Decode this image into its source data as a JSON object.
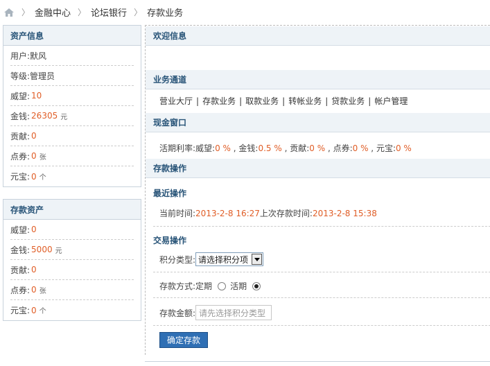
{
  "breadcrumb": {
    "items": [
      "金融中心",
      "论坛银行",
      "存款业务"
    ]
  },
  "assets": {
    "title": "资产信息",
    "rows": [
      {
        "label": "用户: ",
        "value": "默风",
        "unit": ""
      },
      {
        "label": "等级: ",
        "value": "管理员",
        "unit": ""
      },
      {
        "label": "威望: ",
        "value": "10",
        "unit": ""
      },
      {
        "label": "金钱: ",
        "value": "26305",
        "unit": "元"
      },
      {
        "label": "贡献: ",
        "value": "0",
        "unit": ""
      },
      {
        "label": "点券: ",
        "value": "0",
        "unit": "张"
      },
      {
        "label": "元宝: ",
        "value": "0",
        "unit": "个"
      }
    ]
  },
  "deposits": {
    "title": "存款资产",
    "rows": [
      {
        "label": "威望: ",
        "value": "0",
        "unit": ""
      },
      {
        "label": "金钱: ",
        "value": "5000",
        "unit": "元"
      },
      {
        "label": "贡献: ",
        "value": "0",
        "unit": ""
      },
      {
        "label": "点券: ",
        "value": "0",
        "unit": "张"
      },
      {
        "label": "元宝: ",
        "value": "0",
        "unit": "个"
      }
    ]
  },
  "main": {
    "welcome_title": "欢迎信息",
    "channel_title": "业务通道",
    "channels": [
      "营业大厅",
      "存款业务",
      "取款业务",
      "转帐业务",
      "贷款业务",
      "帐户管理"
    ],
    "cash_title": "现金窗口",
    "rate": {
      "prefix": "活期利率: ",
      "items": [
        {
          "label": "威望: ",
          "value": "0 %"
        },
        {
          "label": "金钱: ",
          "value": "0.5 %"
        },
        {
          "label": "贡献: ",
          "value": "0 %"
        },
        {
          "label": "点券: ",
          "value": "0 %"
        },
        {
          "label": "元宝: ",
          "value": "0 %"
        }
      ]
    },
    "deposit_title": "存款操作",
    "recent_title": "最近操作",
    "time_label": "当前时间: ",
    "time_value": "2013-2-8 16:27",
    "last_label": " 上次存款时间: ",
    "last_value": "2013-2-8 15:38",
    "trade_title": "交易操作",
    "type_label": "积分类型: ",
    "type_select": "请选择积分项",
    "method_label": "存款方式: ",
    "method_fixed": "定期",
    "method_current": "活期",
    "amount_label": "存款金额: ",
    "amount_placeholder": "请先选择积分类型",
    "submit_label": "确定存款"
  }
}
